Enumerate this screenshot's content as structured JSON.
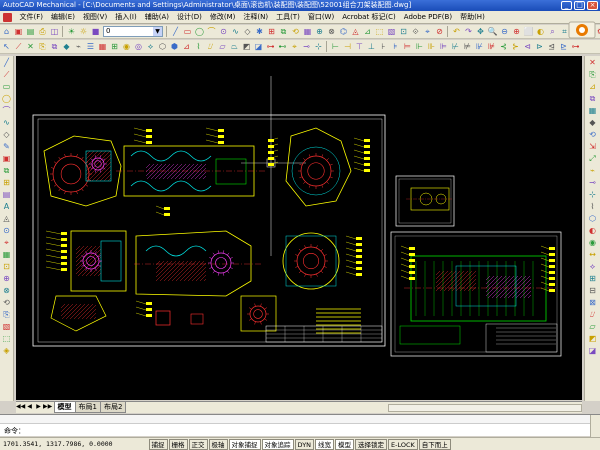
{
  "window": {
    "title": "AutoCAD Mechanical - [C:\\Documents and Settings\\Administrator\\桌面\\滚齿机\\装配图\\装配图\\52001组合刀架装配图.dwg]",
    "minimize_glyph": "_",
    "maximize_glyph": "□",
    "close_glyph": "×"
  },
  "menu": {
    "items": [
      "文件(F)",
      "编辑(E)",
      "视图(V)",
      "插入(I)",
      "辅助(A)",
      "设计(D)",
      "修改(M)",
      "注释(N)",
      "工具(T)",
      "窗口(W)",
      "Acrobat 标记(C)",
      "Adobe PDF(B)",
      "帮助(H)"
    ]
  },
  "toolbar": {
    "layer_value": "0",
    "dropdown_glyph": "▼"
  },
  "tabs": {
    "items": [
      "模型",
      "布局1",
      "布局2"
    ],
    "active": "模型",
    "nav": [
      "◀◀",
      "◀",
      "▶",
      "▶▶"
    ]
  },
  "command_line": {
    "prompt": "命令："
  },
  "status": {
    "coordinates": "1701.3541, 1317.7986, 0.0000",
    "buttons": [
      "捕捉",
      "栅格",
      "正交",
      "极轴",
      "对象捕捉",
      "对象追踪",
      "DYN",
      "线宽",
      "模型",
      "选择锁定",
      "E-LOCK",
      "自下而上"
    ],
    "on_buttons": [
      "对象捕捉",
      "对象追踪",
      "线宽",
      "模型"
    ]
  },
  "drawing": {
    "background": "#000000",
    "frame_color": "#ffffff",
    "yellow": "#ffff00",
    "red": "#ff3030",
    "green": "#00e000",
    "cyan": "#00e0e0",
    "magenta": "#ff40ff"
  }
}
